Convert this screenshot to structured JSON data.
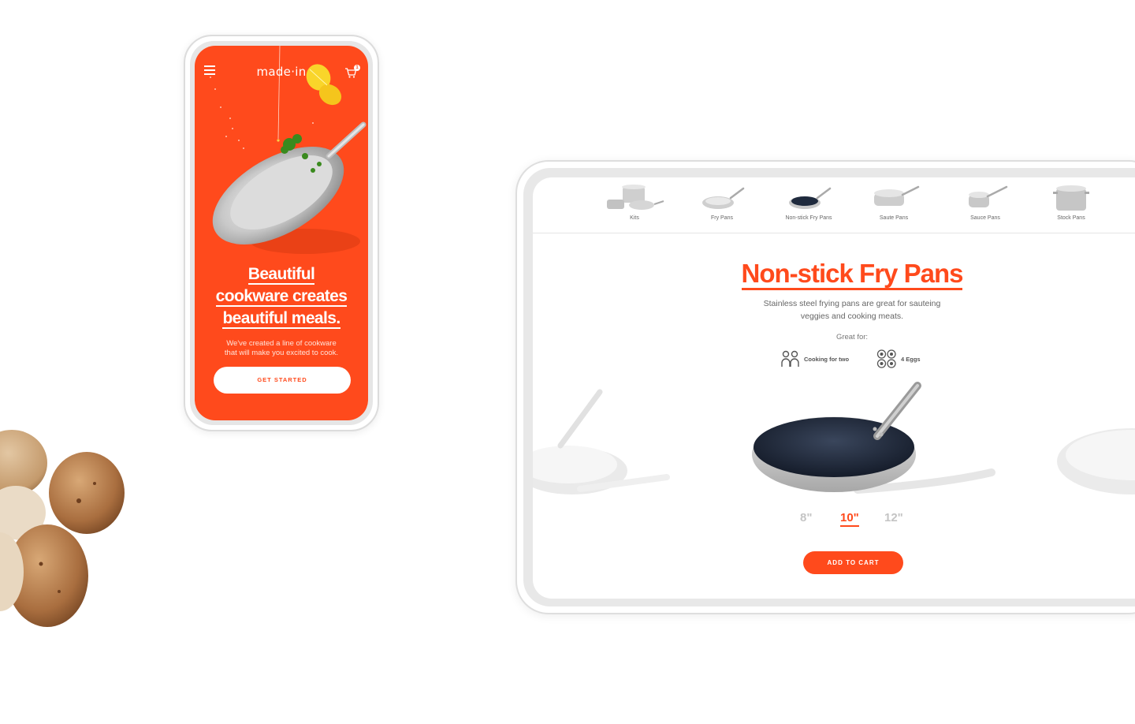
{
  "phone": {
    "logo": "made·in",
    "cart_count": "1",
    "headline_lines": [
      "Beautiful",
      "cookware creates",
      "beautiful meals."
    ],
    "subtext_lines": [
      "We've created a line of cookware",
      "that will make you excited to cook."
    ],
    "cta_label": "GET STARTED"
  },
  "tablet": {
    "categories": [
      {
        "label": "Kits",
        "icon": "cookware-set-icon"
      },
      {
        "label": "Fry Pans",
        "icon": "fry-pan-icon"
      },
      {
        "label": "Non-stick Fry Pans",
        "icon": "nonstick-pan-icon"
      },
      {
        "label": "Saute Pans",
        "icon": "saute-pan-icon"
      },
      {
        "label": "Sauce Pans",
        "icon": "sauce-pan-icon"
      },
      {
        "label": "Stock Pans",
        "icon": "stock-pot-icon"
      }
    ],
    "title": "Non-stick Fry Pans",
    "description_lines": [
      "Stainless steel frying pans are great for sauteing",
      "veggies and cooking meats."
    ],
    "great_for_label": "Great for:",
    "features": [
      {
        "label": "Cooking for two",
        "icon": "two-people-icon"
      },
      {
        "label": "4 Eggs",
        "icon": "eggs-icon"
      }
    ],
    "sizes": [
      "8\"",
      "10\"",
      "12\""
    ],
    "selected_size": "10\"",
    "cta_label": "ADD TO CART"
  },
  "colors": {
    "brand_orange": "#ff4a1c",
    "nonstick_coating": "#1f2a3d"
  }
}
